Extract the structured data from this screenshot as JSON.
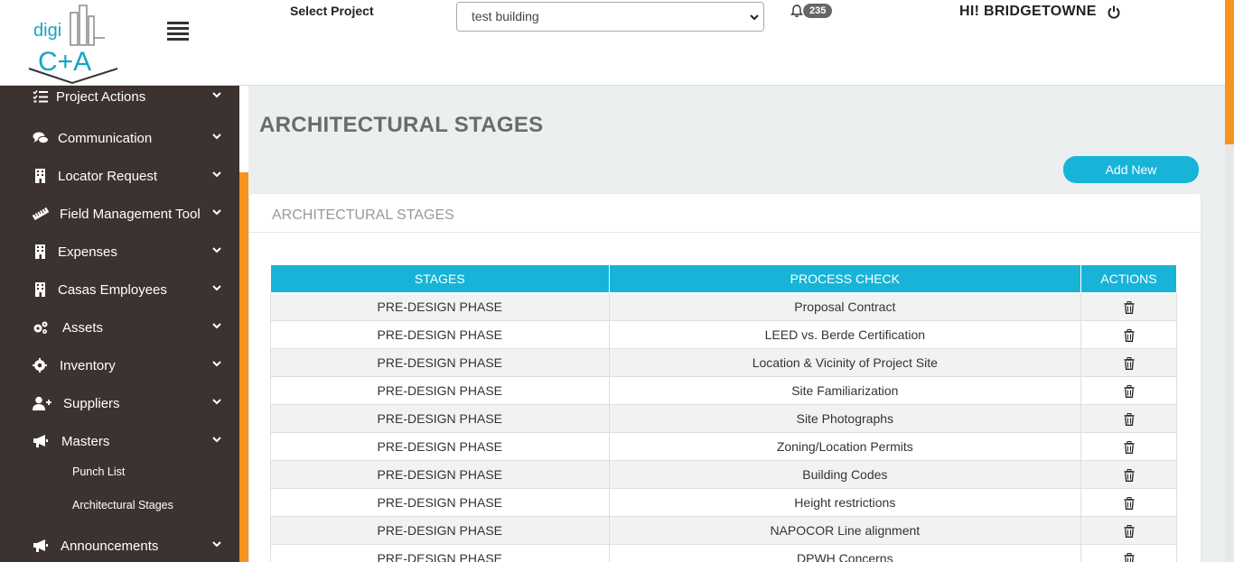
{
  "brand": {
    "logo_text_top": "digi",
    "logo_text_bottom": "C+A"
  },
  "header": {
    "select_label": "Select Project",
    "selected_project": "test building",
    "notification_count": "235",
    "greeting": "HI! BRIDGETOWNE"
  },
  "sidebar": {
    "items": [
      {
        "label": "Project Actions",
        "icon": "list-check-icon"
      },
      {
        "label": "Communication",
        "icon": "chat-icon"
      },
      {
        "label": "Locator Request",
        "icon": "building-icon"
      },
      {
        "label": "Field Management Tool",
        "icon": "ruler-icon"
      },
      {
        "label": "Expenses",
        "icon": "building-icon"
      },
      {
        "label": "Casas Employees",
        "icon": "building-icon"
      },
      {
        "label": "Assets",
        "icon": "cogs-icon"
      },
      {
        "label": "Inventory",
        "icon": "gear-icon"
      },
      {
        "label": "Suppliers",
        "icon": "user-plus-icon"
      },
      {
        "label": "Masters",
        "icon": "megaphone-icon"
      },
      {
        "label": "Announcements",
        "icon": "megaphone-icon"
      }
    ],
    "sub_items": [
      {
        "label": "Punch List"
      },
      {
        "label": "Architectural Stages"
      }
    ]
  },
  "main": {
    "page_title": "ARCHITECTURAL STAGES",
    "add_button": "Add New",
    "card_title": "ARCHITECTURAL STAGES",
    "table": {
      "columns": [
        "STAGES",
        "PROCESS CHECK",
        "ACTIONS"
      ],
      "rows": [
        {
          "stage": "PRE-DESIGN PHASE",
          "process": "Proposal Contract"
        },
        {
          "stage": "PRE-DESIGN PHASE",
          "process": "LEED vs. Berde Certification"
        },
        {
          "stage": "PRE-DESIGN PHASE",
          "process": "Location & Vicinity of Project Site"
        },
        {
          "stage": "PRE-DESIGN PHASE",
          "process": "Site Familiarization"
        },
        {
          "stage": "PRE-DESIGN PHASE",
          "process": "Site Photographs"
        },
        {
          "stage": "PRE-DESIGN PHASE",
          "process": "Zoning/Location Permits"
        },
        {
          "stage": "PRE-DESIGN PHASE",
          "process": "Building Codes"
        },
        {
          "stage": "PRE-DESIGN PHASE",
          "process": "Height restrictions"
        },
        {
          "stage": "PRE-DESIGN PHASE",
          "process": "NAPOCOR Line alignment"
        },
        {
          "stage": "PRE-DESIGN PHASE",
          "process": "DPWH Concerns"
        }
      ]
    }
  },
  "colors": {
    "accent": "#17b4d8",
    "sidebar_bg": "#3c3230",
    "stripe": "#f7941d"
  }
}
